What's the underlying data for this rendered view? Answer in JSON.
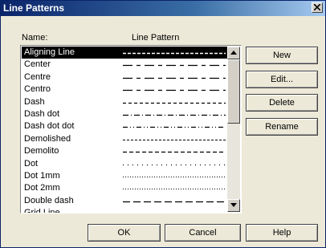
{
  "window": {
    "title": "Line Patterns"
  },
  "columns": {
    "name": "Name:",
    "pattern": "Line Pattern"
  },
  "patterns": [
    {
      "name": "Aligning Line",
      "dash": "4 2",
      "width": 1.6,
      "selected": true
    },
    {
      "name": "Center",
      "dash": "12 5 5 5",
      "width": 1.3
    },
    {
      "name": "Centre",
      "dash": "12 5 5 5",
      "width": 1.3
    },
    {
      "name": "Centro",
      "dash": "12 5 5 5",
      "width": 1.3
    },
    {
      "name": "Dash",
      "dash": "4 3",
      "width": 1.3
    },
    {
      "name": "Dash dot",
      "dash": "7 3 1 3",
      "width": 1.3
    },
    {
      "name": "Dash dot dot",
      "dash": "6 3 1 3 1 3",
      "width": 1.3
    },
    {
      "name": "Demolished",
      "dash": "3 2",
      "width": 1.1
    },
    {
      "name": "Demolito",
      "dash": "5 3",
      "width": 1.3
    },
    {
      "name": "Dot",
      "dash": "1 5",
      "width": 1.2
    },
    {
      "name": "Dot 1mm",
      "dash": "1 2",
      "width": 1.0
    },
    {
      "name": "Dot 2mm",
      "dash": "1 2",
      "width": 1.0
    },
    {
      "name": "Double dash",
      "dash": "9 4 9 4",
      "width": 1.3
    },
    {
      "name": "Grid Line",
      "dash": "12 3 3 3",
      "width": 1.3
    }
  ],
  "actions": {
    "new": "New",
    "edit": "Edit...",
    "delete": "Delete",
    "rename": "Rename"
  },
  "footer": {
    "ok": "OK",
    "cancel": "Cancel",
    "help": "Help"
  },
  "icons": {
    "close": "close-icon",
    "scroll_up": "arrow-up-icon",
    "scroll_down": "arrow-down-icon"
  }
}
